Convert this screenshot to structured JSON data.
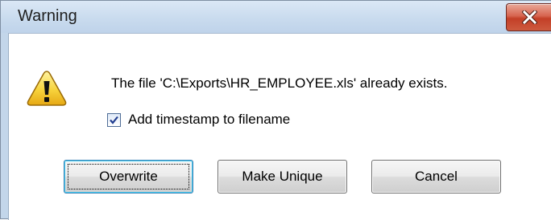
{
  "dialog": {
    "title": "Warning",
    "message": "The file 'C:\\Exports\\HR_EMPLOYEE.xls' already exists.",
    "icon": "warning-icon",
    "checkbox": {
      "label": "Add timestamp to filename",
      "checked": true
    },
    "buttons": {
      "overwrite": "Overwrite",
      "make_unique": "Make Unique",
      "cancel": "Cancel"
    }
  },
  "colors": {
    "close_button": "#c8452c",
    "titlebar": "#c9dbee"
  }
}
